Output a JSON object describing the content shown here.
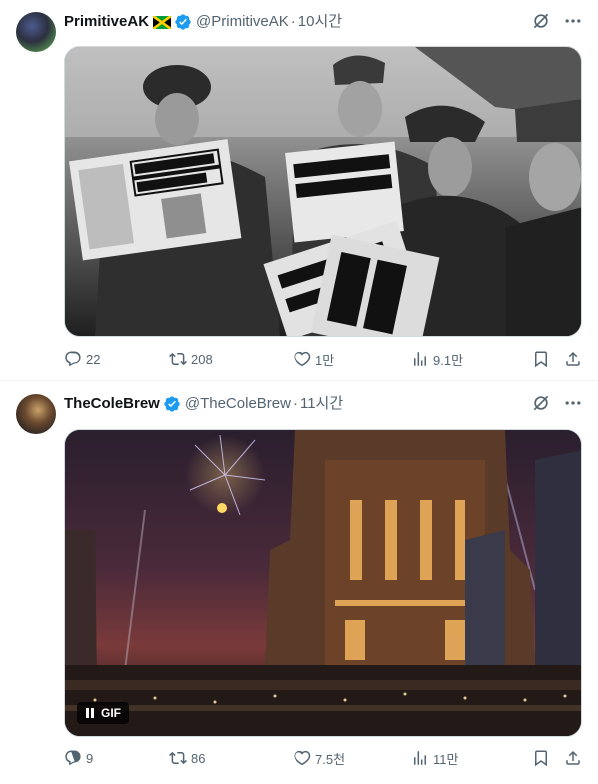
{
  "tweets": [
    {
      "name": "PrimitiveAK",
      "flag": "jamaica-flag",
      "handle": "@PrimitiveAK",
      "separator": "·",
      "time": "10시간",
      "media": {
        "type": "photo",
        "description_icon": "photo"
      },
      "stats": {
        "replies": "22",
        "reposts": "208",
        "likes": "1만",
        "views": "9.1만"
      }
    },
    {
      "name": "TheColeBrew",
      "handle": "@TheColeBrew",
      "separator": "·",
      "time": "11시간",
      "media": {
        "type": "gif",
        "badge": "GIF"
      },
      "stats": {
        "replies": "9",
        "reposts": "86",
        "likes": "7.5천",
        "views": "11만"
      }
    }
  ],
  "colors": {
    "verified": "#1d9bf0",
    "secondary_text": "#536471",
    "primary_text": "#0f1419",
    "divider": "#eff3f4"
  }
}
